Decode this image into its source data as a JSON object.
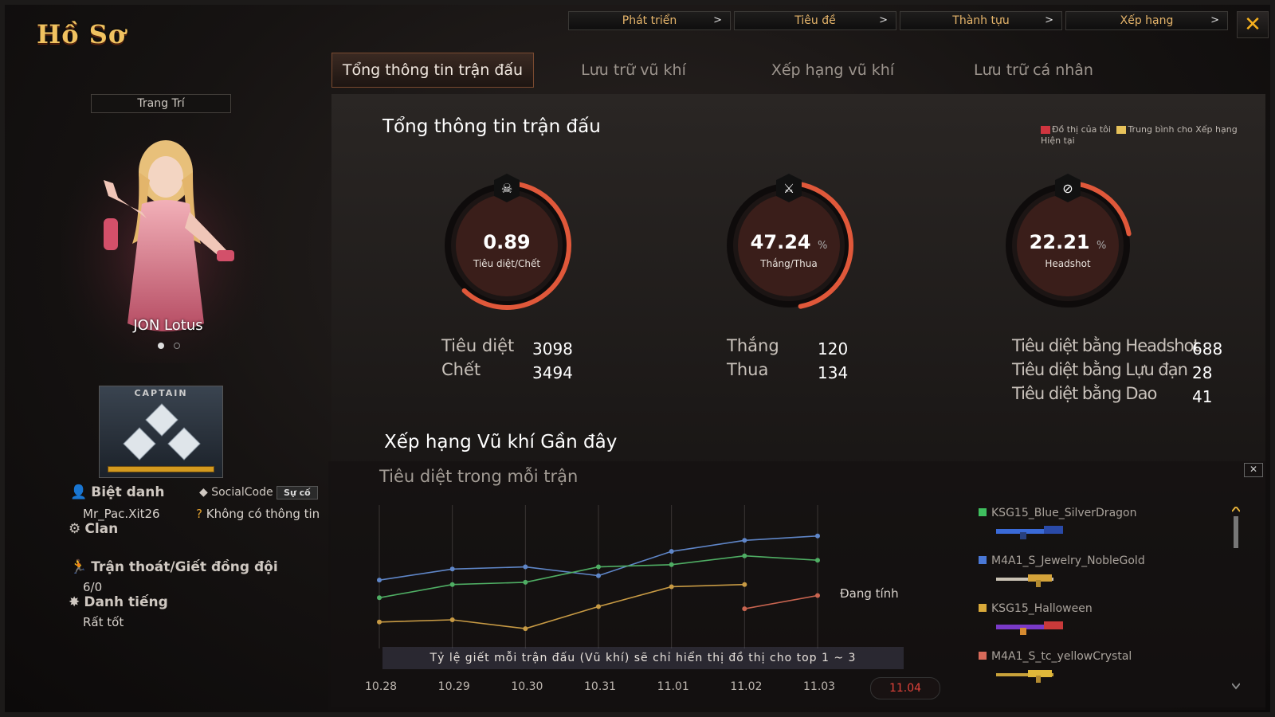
{
  "window": {
    "title": "Hồ Sơ",
    "close_icon": "close-icon"
  },
  "topnav": [
    {
      "label": "Phát triển"
    },
    {
      "label": "Tiêu đề"
    },
    {
      "label": "Thành tựu"
    },
    {
      "label": "Xếp hạng"
    }
  ],
  "tabs": [
    {
      "label": "Tổng thông tin trận đấu",
      "active": true
    },
    {
      "label": "Lưu trữ vũ khí"
    },
    {
      "label": "Xếp hạng vũ khí"
    },
    {
      "label": "Lưu trữ cá nhân"
    }
  ],
  "profile": {
    "decor_label": "Trang Trí",
    "character_name": "JON Lotus",
    "rank_label": "CAPTAIN",
    "nickname_label": "Biệt danh",
    "nickname_value": "Mr_Pac.Xit26",
    "socialcode_label": "SocialCode",
    "socialcode_button": "Sự cố",
    "socialcode_value": "Không có thông tin",
    "clan_label": "Clan",
    "escape_label": "Trận thoát/Giết đồng đội",
    "escape_value": "6/0",
    "reputation_label": "Danh tiếng",
    "reputation_value": "Rất tốt"
  },
  "summary": {
    "title": "Tổng thông tin trận đấu",
    "legend_mine": "Đồ thị của tôi",
    "legend_avg": "Trung bình cho Xếp hạng Hiện tại",
    "gauges": [
      {
        "value": "0.89",
        "unit": "",
        "label": "Tiêu diệt/Chết",
        "icon": "skull-icon",
        "fraction": 0.62
      },
      {
        "value": "47.24",
        "unit": "%",
        "label": "Thắng/Thua",
        "icon": "crossed-swords-icon",
        "fraction": 0.47
      },
      {
        "value": "22.21",
        "unit": "%",
        "label": "Headshot",
        "icon": "headshot-icon",
        "fraction": 0.22
      }
    ],
    "kd": {
      "kills_label": "Tiêu diệt",
      "kills": "3098",
      "deaths_label": "Chết",
      "deaths": "3494"
    },
    "wl": {
      "win_label": "Thắng",
      "win": "120",
      "lose_label": "Thua",
      "lose": "134"
    },
    "hs": {
      "headshot_label": "Tiêu diệt bằng Headshot",
      "headshot": "688",
      "grenade_label": "Tiêu diệt bằng Lựu đạn",
      "grenade": "28",
      "knife_label": "Tiêu diệt bằng Dao",
      "knife": "41"
    }
  },
  "weapons_section": {
    "title": "Xếp hạng Vũ khí Gần đây",
    "subtitle": "Tiêu diệt trong mỗi trận",
    "calculating": "Đang tính",
    "note": "Tỷ lệ giết mỗi trận đấu (Vũ khí) sẽ chỉ hiển thị đồ thị cho top 1 ~ 3",
    "active_day": "11.04"
  },
  "weapons": [
    {
      "name": "KSG15_Blue_SilverDragon",
      "color": "#3fbf5f"
    },
    {
      "name": "M4A1_S_Jewelry_NobleGold",
      "color": "#4a78d6"
    },
    {
      "name": "KSG15_Halloween",
      "color": "#d9a93a"
    },
    {
      "name": "M4A1_S_tc_yellowCrystal",
      "color": "#d86a5a"
    }
  ],
  "chart_data": {
    "type": "line",
    "x": [
      "10.28",
      "10.29",
      "10.30",
      "10.31",
      "11.01",
      "11.02",
      "11.03"
    ],
    "series": [
      {
        "values": [
          1.6,
          2.1,
          2.2,
          1.8,
          2.9,
          3.4,
          3.6
        ],
        "color": "#5f86c8"
      },
      {
        "values": [
          0.8,
          1.4,
          1.5,
          2.2,
          2.3,
          2.7,
          2.5
        ],
        "color": "#4fae64"
      },
      {
        "values": [
          -0.3,
          -0.2,
          -0.6,
          0.4,
          1.3,
          1.4,
          null
        ],
        "color": "#c79a44"
      },
      {
        "values": [
          null,
          null,
          null,
          null,
          null,
          0.3,
          0.9
        ],
        "color": "#c86450"
      }
    ],
    "ylim": [
      -1.5,
      5
    ]
  }
}
